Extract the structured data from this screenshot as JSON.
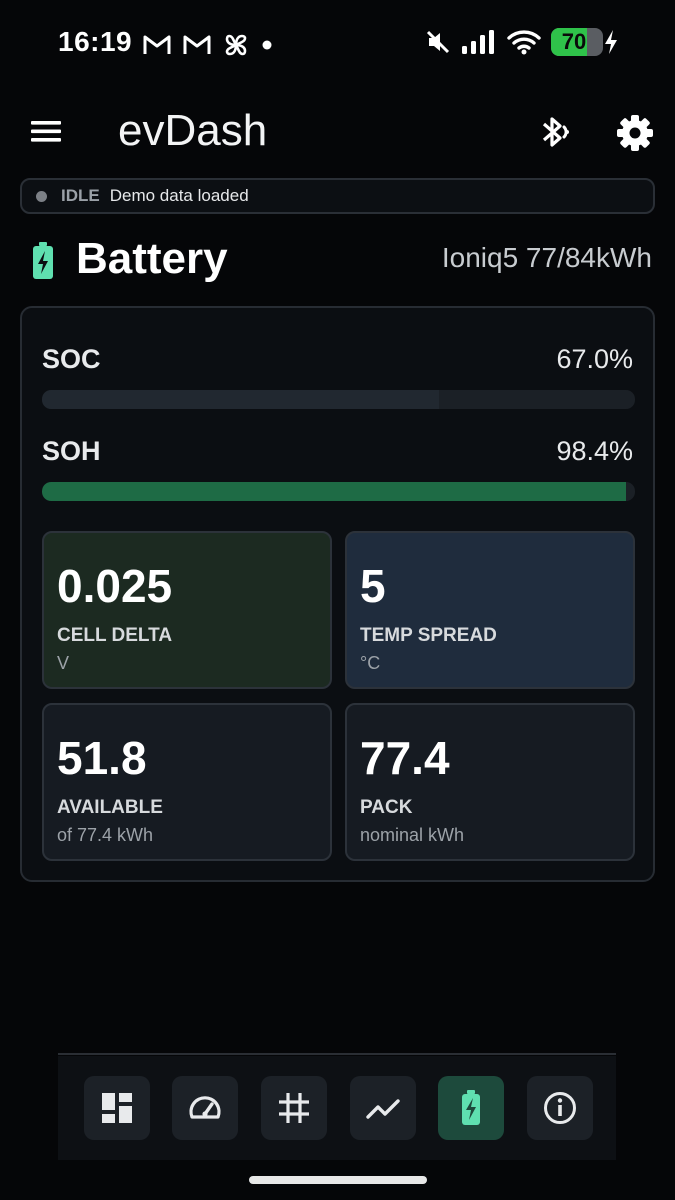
{
  "status_bar": {
    "time": "16:19",
    "battery_level": "70",
    "battery_fraction": 0.7,
    "icons": [
      "gmail-icon",
      "gmail-icon",
      "pinwheel-icon",
      "dot-icon",
      "mute-icon",
      "signal-icon",
      "wifi-icon",
      "charging-icon"
    ]
  },
  "app_bar": {
    "title": "evDash",
    "icons": [
      "menu-icon",
      "bluetooth-searching-icon",
      "gear-icon"
    ]
  },
  "status": {
    "state": "IDLE",
    "message": "Demo data loaded"
  },
  "section": {
    "title": "Battery",
    "model": "Ioniq5 77/84kWh",
    "icon": "battery-charging-icon"
  },
  "soc": {
    "label": "SOC",
    "value_text": "67.0%",
    "fraction": 0.67
  },
  "soh": {
    "label": "SOH",
    "value_text": "98.4%",
    "fraction": 0.984
  },
  "tiles": [
    {
      "value": "0.025",
      "label": "CELL DELTA",
      "unit": "V",
      "bg": "#1c2a21"
    },
    {
      "value": "5",
      "label": "TEMP SPREAD",
      "unit": "°C",
      "bg": "#1f2c3d"
    },
    {
      "value": "51.8",
      "label": "AVAILABLE",
      "unit": "of 77.4 kWh",
      "bg": "#161b22"
    },
    {
      "value": "77.4",
      "label": "PACK",
      "unit": "nominal kWh",
      "bg": "#161b22"
    }
  ],
  "bottom_nav": {
    "items": [
      "dashboard-icon",
      "speedometer-icon",
      "grid-icon",
      "chart-line-icon",
      "battery-charging-icon",
      "info-icon"
    ],
    "active_index": 4
  },
  "colors": {
    "soh_fill": "#1e6b45",
    "soc_fill": "#212830",
    "accent_green": "#5fe0b0",
    "active_nav": "#1d4a3c"
  }
}
